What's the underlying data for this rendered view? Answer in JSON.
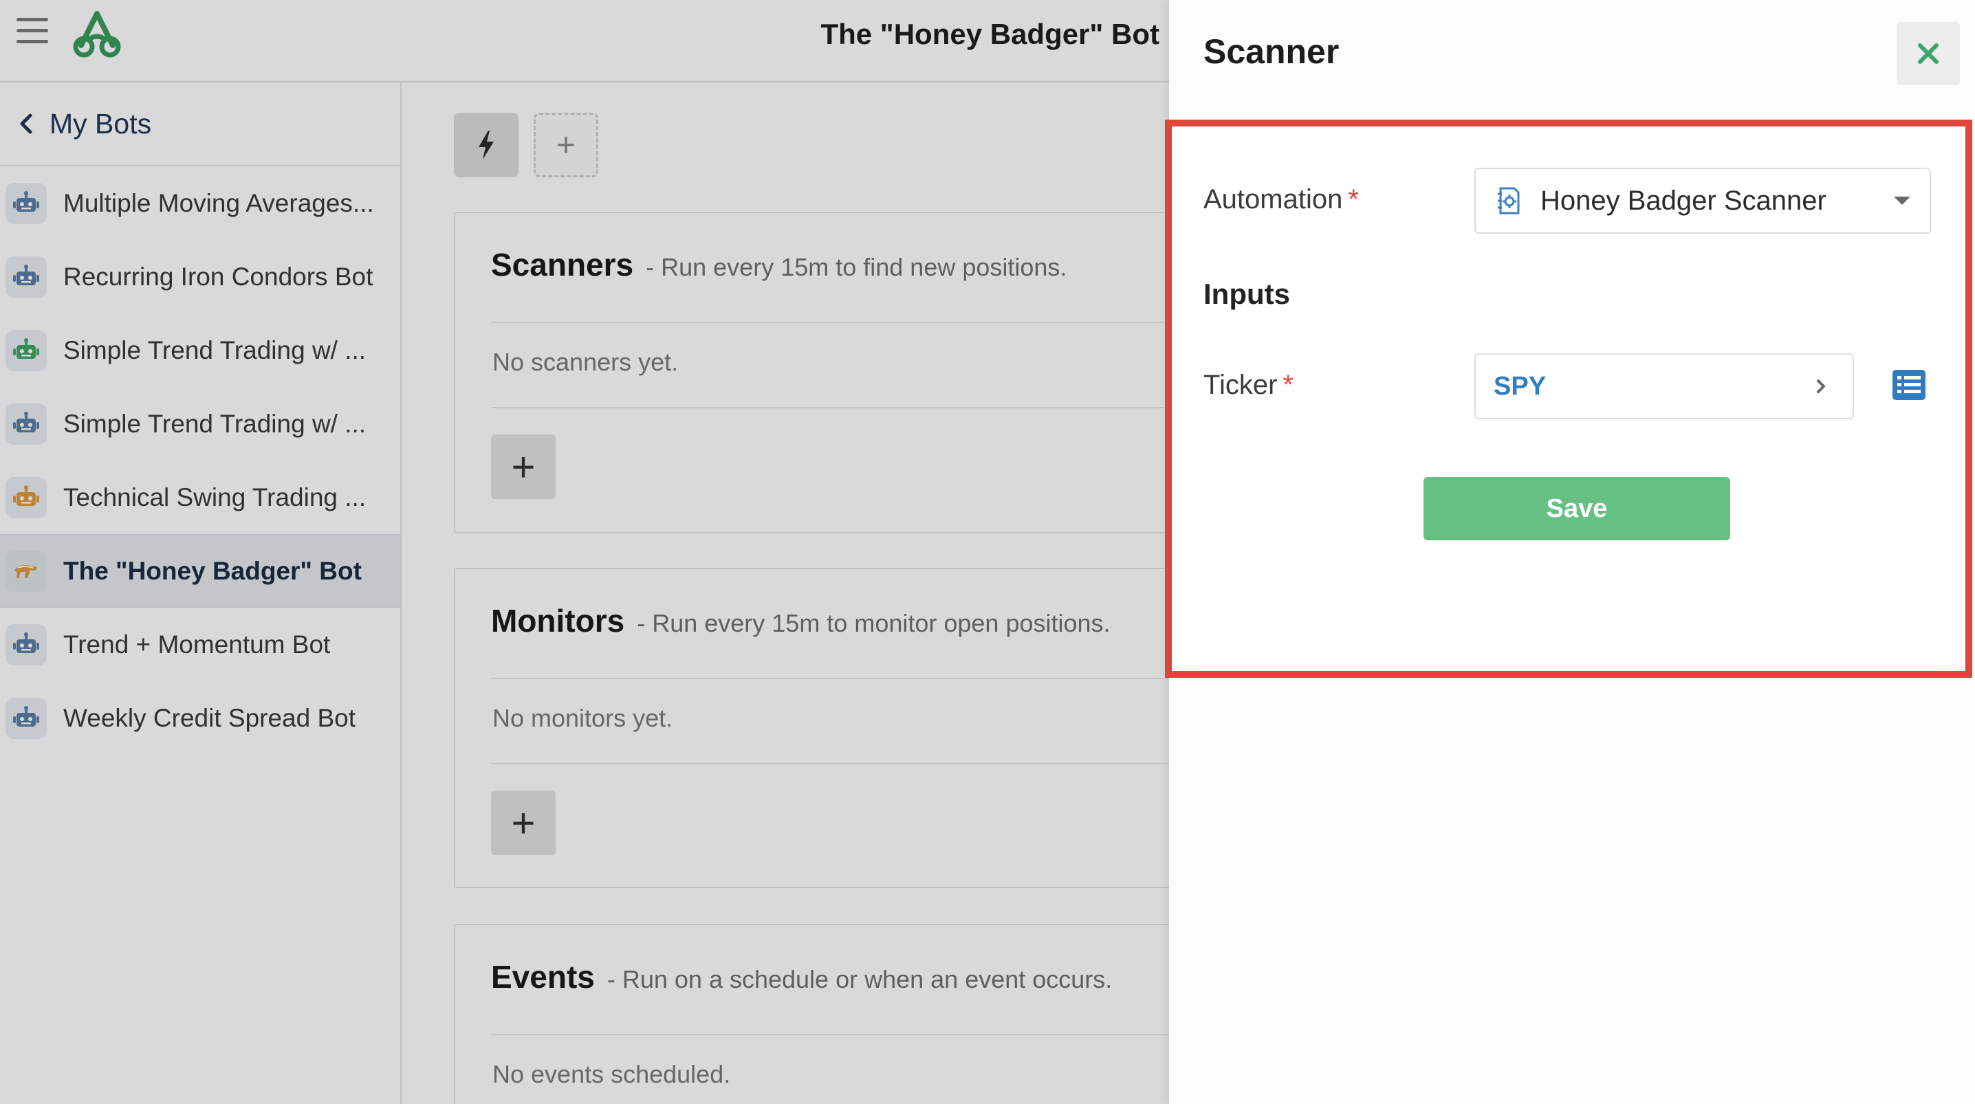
{
  "header": {
    "title": "The \"Honey Badger\" Bot"
  },
  "sidebar": {
    "back_label": "My Bots",
    "items": [
      {
        "label": "Multiple Moving Averages...",
        "icon": "robot-icon",
        "color": "#5b7fa6",
        "active": false
      },
      {
        "label": "Recurring Iron Condors Bot",
        "icon": "robot-icon",
        "color": "#5b7fa6",
        "active": false
      },
      {
        "label": "Simple Trend Trading w/ ...",
        "icon": "robot-icon",
        "color": "#3fa76a",
        "active": false
      },
      {
        "label": "Simple Trend Trading w/ ...",
        "icon": "robot-icon",
        "color": "#5b7fa6",
        "active": false
      },
      {
        "label": "Technical Swing Trading ...",
        "icon": "robot-icon",
        "color": "#e29a3f",
        "active": false
      },
      {
        "label": "The \"Honey Badger\" Bot",
        "icon": "honey-badger-icon",
        "color": "#e29a3f",
        "active": true
      },
      {
        "label": "Trend + Momentum Bot",
        "icon": "robot-icon",
        "color": "#5b7fa6",
        "active": false
      },
      {
        "label": "Weekly Credit Spread Bot",
        "icon": "robot-icon",
        "color": "#5b7fa6",
        "active": false
      }
    ]
  },
  "toolbar": {
    "bolt_icon": "lightning-bolt-icon",
    "add_label": "+"
  },
  "sections": {
    "scanners": {
      "title": "Scanners",
      "desc": "- Run every 15m to find new positions.",
      "empty": "No scanners yet.",
      "add_label": "+"
    },
    "monitors": {
      "title": "Monitors",
      "desc": "- Run every 15m to monitor open positions.",
      "empty": "No monitors yet.",
      "add_label": "+"
    },
    "events": {
      "title": "Events",
      "desc": "- Run on a schedule or when an event occurs.",
      "empty": "No events scheduled."
    }
  },
  "drawer": {
    "title": "Scanner",
    "automation": {
      "label": "Automation",
      "required": "*",
      "value": "Honey Badger Scanner"
    },
    "inputs_heading": "Inputs",
    "ticker": {
      "label": "Ticker",
      "required": "*",
      "value": "SPY"
    },
    "save_label": "Save"
  },
  "colors": {
    "accent_blue": "#2f7dc0",
    "save_green": "#67c083",
    "highlight_red": "#e0453b",
    "close_green": "#3aa56a"
  }
}
